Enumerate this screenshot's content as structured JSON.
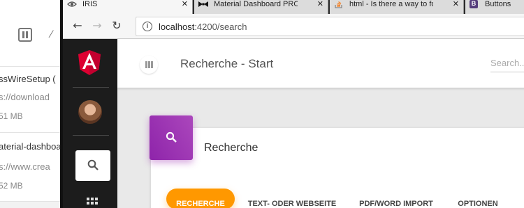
{
  "downloads": {
    "items": [
      {
        "name": "ssWireSetup (",
        "url": "s://download",
        "size": "51 MB"
      },
      {
        "name": "aterial-dashboa",
        "url": "s://www.crea",
        "size": "52 MB"
      }
    ]
  },
  "browser": {
    "tabs": [
      {
        "label": "IRIS",
        "icon": "eye-icon",
        "active": true
      },
      {
        "label": "Material Dashboard PRO",
        "icon": "bowtie-icon",
        "active": false
      },
      {
        "label": "html - Is there a way to fo",
        "icon": "stackoverflow-icon",
        "active": false
      },
      {
        "label": "Buttons",
        "icon": "bootstrap-icon",
        "active": false
      }
    ],
    "address": {
      "host": "localhost",
      "path": ":4200/search"
    }
  },
  "app": {
    "page_title": "Recherche - Start",
    "search_placeholder": "Search...",
    "card_title": "Recherche",
    "tabs": [
      {
        "label": "RECHERCHE",
        "active": true
      },
      {
        "label": "TEXT- ODER WEBSEITE",
        "active": false
      },
      {
        "label": "PDF/WORD IMPORT",
        "active": false
      },
      {
        "label": "OPTIONEN",
        "active": false
      }
    ]
  },
  "colors": {
    "accent_purple": "#9c27b0",
    "accent_orange": "#ff9800",
    "sidebar": "#1c1c1c",
    "angular_red": "#dd0031"
  }
}
